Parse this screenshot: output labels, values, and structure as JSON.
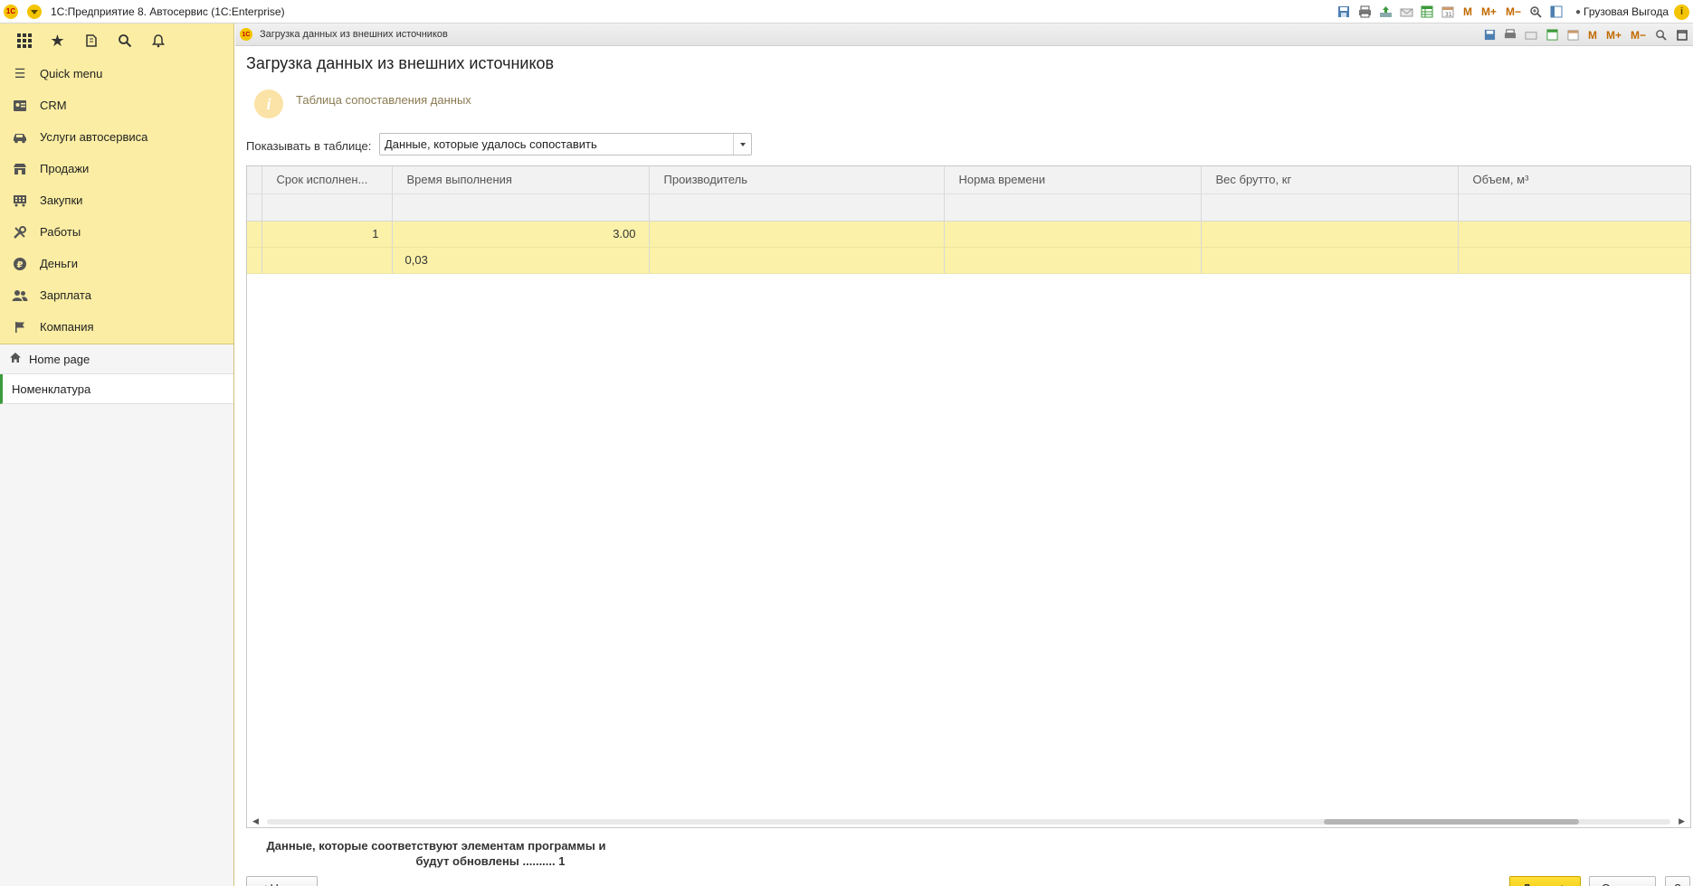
{
  "app": {
    "title": "1С:Предприятие 8. Автосервис  (1С:Enterprise)",
    "user": "Грузовая Выгода",
    "logo_text": "1С"
  },
  "toolbar_icons": [
    "save-icon",
    "print-icon",
    "upload-icon",
    "mail-icon",
    "table-icon",
    "calendar-icon",
    "m-label",
    "m-plus-label",
    "m-minus-label",
    "zoom-icon",
    "panel-icon",
    "user-icon",
    "info-icon"
  ],
  "toolbar_m": {
    "m": "M",
    "m_plus": "M+",
    "m_minus": "M−"
  },
  "sidebar": {
    "items": [
      {
        "label": "Quick menu",
        "icon": "hamburger-icon"
      },
      {
        "label": "CRM",
        "icon": "contacts-icon"
      },
      {
        "label": "Услуги автосервиса",
        "icon": "car-icon"
      },
      {
        "label": "Продажи",
        "icon": "shop-icon"
      },
      {
        "label": "Закупки",
        "icon": "cart-icon"
      },
      {
        "label": "Работы",
        "icon": "tools-icon"
      },
      {
        "label": "Деньги",
        "icon": "ruble-icon"
      },
      {
        "label": "Зарплата",
        "icon": "people-icon"
      },
      {
        "label": "Компания",
        "icon": "flag-icon"
      }
    ],
    "home": "Home page",
    "open_window": "Номенклатура"
  },
  "window": {
    "tab_title": "Загрузка данных из внешних источников",
    "form_title": "Загрузка данных из внешних источников",
    "info_text": "Таблица сопоставления данных",
    "filter_label": "Показывать в таблице:",
    "filter_value": "Данные, которые удалось сопоставить"
  },
  "grid": {
    "columns": [
      "Срок исполнен...",
      "Время выполнения",
      "Производитель",
      "Норма времени",
      "Вес брутто, кг",
      "Объем, м³"
    ],
    "rows": [
      [
        "1",
        "3.00",
        "",
        "",
        "",
        ""
      ],
      [
        "",
        "0,03",
        "",
        "",
        "",
        ""
      ]
    ]
  },
  "summary": {
    "line1": "Данные, которые соответствуют элементам программы и",
    "line2": "будут обновлены .......... 1"
  },
  "buttons": {
    "back": "< Назад",
    "next": "Далее >",
    "cancel": "Отмена",
    "help": "?"
  }
}
